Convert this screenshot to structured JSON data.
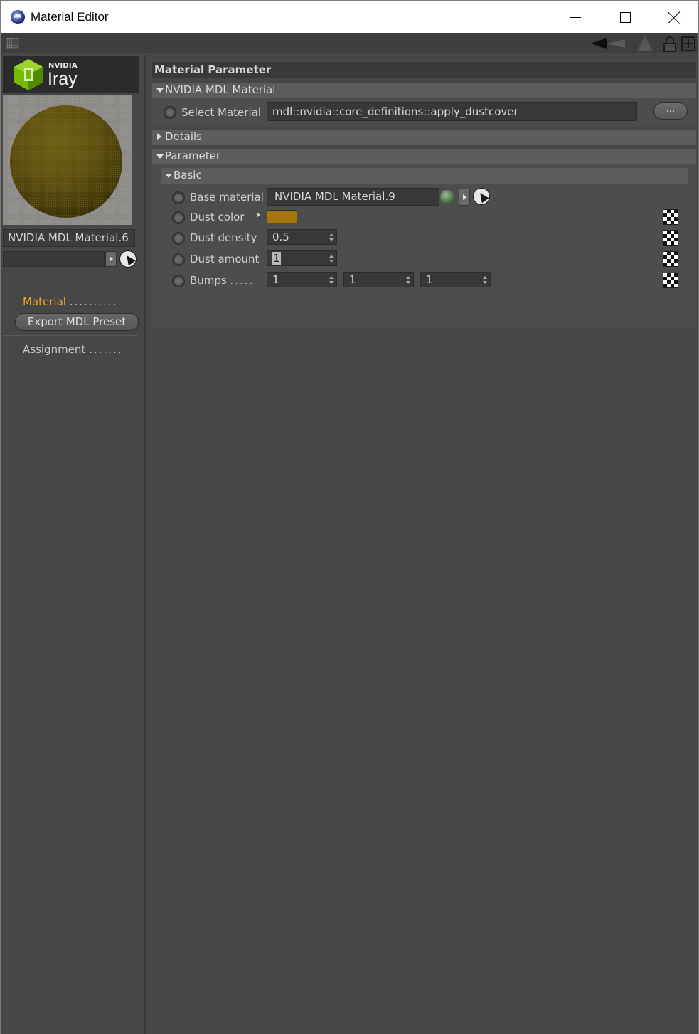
{
  "window": {
    "title": "Material Editor",
    "icon": "cinema4d-app-icon"
  },
  "left": {
    "logo_brand": "NVIDIA",
    "logo_product": "Iray",
    "material_name": "NVIDIA MDL Material.6",
    "link_field_value": "",
    "nav_material": "Material",
    "nav_material_dots": "..........",
    "export_button": "Export MDL Preset",
    "nav_assignment": "Assignment",
    "nav_assignment_dots": "......."
  },
  "right": {
    "header": "Material Parameter",
    "group_mdl": "NVIDIA MDL Material",
    "select_material_label": "Select Material",
    "select_material_value": "mdl::nvidia::core_definitions::apply_dustcover",
    "browse_button": "...",
    "group_details": "Details",
    "group_parameter": "Parameter",
    "group_basic": "Basic",
    "base_material_label": "Base material",
    "base_material_value": "NVIDIA MDL Material.9",
    "dust_color_label": "Dust color",
    "dust_color": "#a6760b",
    "dust_density_label": "Dust density",
    "dust_density_value": "0.5",
    "dust_amount_label": "Dust amount",
    "dust_amount_value": "1",
    "bumps_label": "Bumps",
    "bumps_dots": ".....",
    "bumps_x": "1",
    "bumps_y": "1",
    "bumps_z": "1"
  }
}
